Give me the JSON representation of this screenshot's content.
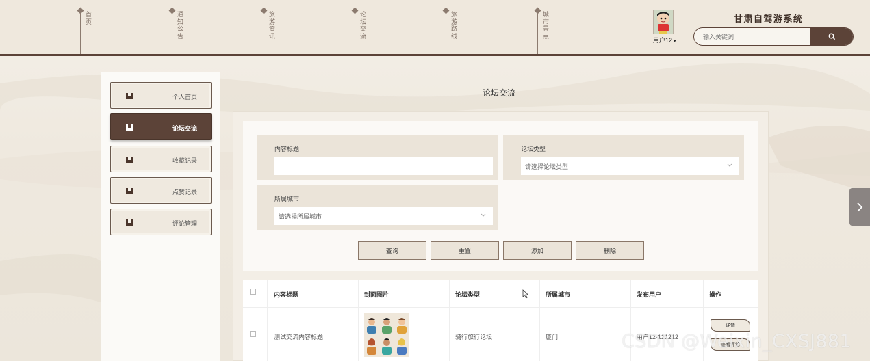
{
  "nav": {
    "items": [
      {
        "label": "首页"
      },
      {
        "label": "通知公告"
      },
      {
        "label": "旅游资讯"
      },
      {
        "label": "论坛交流"
      },
      {
        "label": "旅游路线"
      },
      {
        "label": "城市景点"
      }
    ]
  },
  "header": {
    "site_title": "甘肃自驾游系统",
    "user_label": "用户12",
    "search_placeholder": "输入关键词",
    "search_icon": "search-icon"
  },
  "sidebar": {
    "items": [
      {
        "label": "个人首页",
        "active": false
      },
      {
        "label": "论坛交流",
        "active": true
      },
      {
        "label": "收藏记录",
        "active": false
      },
      {
        "label": "点赞记录",
        "active": false
      },
      {
        "label": "评论管理",
        "active": false
      }
    ]
  },
  "main": {
    "page_title": "论坛交流",
    "filters": {
      "title_label": "内容标题",
      "title_value": "",
      "type_label": "论坛类型",
      "type_placeholder": "请选择论坛类型",
      "city_label": "所属城市",
      "city_placeholder": "请选择所属城市"
    },
    "buttons": {
      "query": "查询",
      "reset": "重置",
      "add": "添加",
      "delete": "删除"
    },
    "table": {
      "headers": [
        "内容标题",
        "封面图片",
        "论坛类型",
        "所属城市",
        "发布用户",
        "操作"
      ],
      "rows": [
        {
          "title": "测试交流内容标题",
          "type": "骑行旅行论坛",
          "city": "厦门",
          "user": "用户12-121212",
          "detail": "详情",
          "comments": "查看评论"
        }
      ]
    }
  },
  "watermark": "CSDN @Weixin_CXSJ881",
  "colors": {
    "brand": "#5c4338",
    "panel": "#ebe4d9",
    "background": "#efe9df"
  }
}
